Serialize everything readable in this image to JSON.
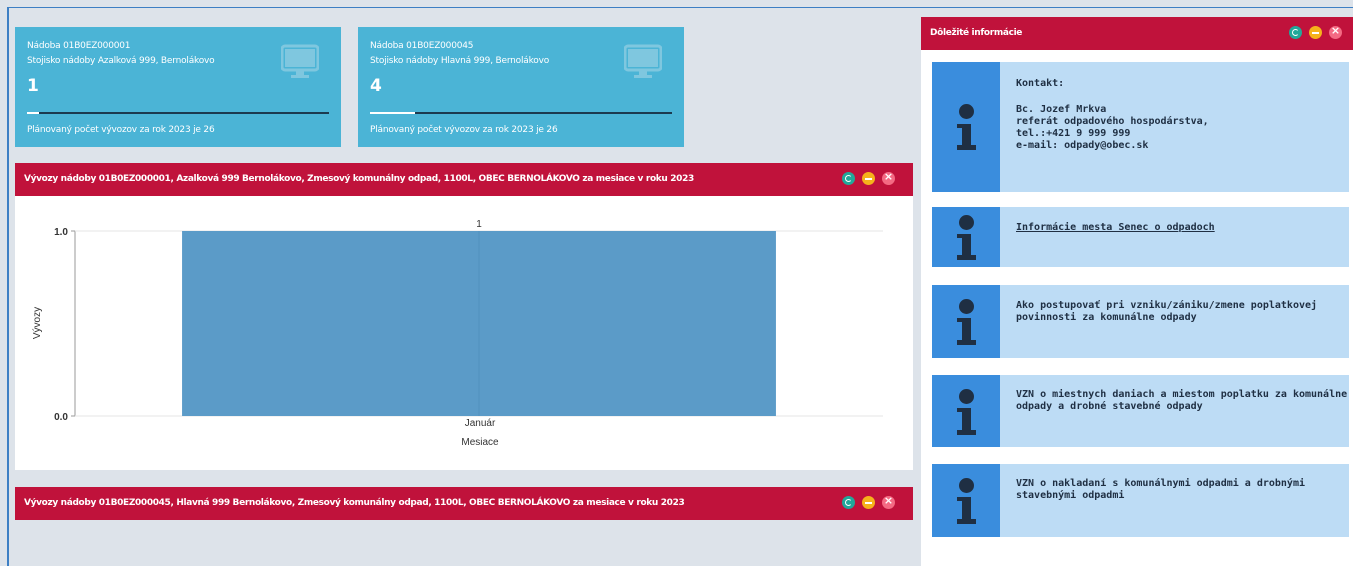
{
  "tiles": [
    {
      "line1": "Nádoba 01B0EZ000001",
      "line2": "Stojisko nádoby Azalková 999, Bernolákovo",
      "count": "1",
      "progress": 0.04,
      "footer": "Plánovaný počet vývozov za rok 2023 je 26",
      "icon": "monitor-icon"
    },
    {
      "line1": "Nádoba 01B0EZ000045",
      "line2": "Stojisko nádoby Hlavná 999, Bernolákovo",
      "count": "4",
      "progress": 0.15,
      "footer": "Plánovaný počet vývozov za rok 2023 je 26",
      "icon": "monitor-icon"
    }
  ],
  "panels": {
    "chart1_title": "Vývozy nádoby 01B0EZ000001, Azalková 999 Bernolákovo, Zmesový komunálny odpad, 1100L, OBEC BERNOLÁKOVO za mesiace v roku 2023",
    "chart2_title": "Vývozy nádoby 01B0EZ000045, Hlavná 999 Bernolákovo, Zmesový komunálny odpad, 1100L, OBEC BERNOLÁKOVO za mesiace v roku 2023",
    "info_title": "Dôležité informácie",
    "controls": [
      "refresh-icon",
      "minimize-icon",
      "close-icon"
    ]
  },
  "chart_data": {
    "type": "bar",
    "categories": [
      "Január"
    ],
    "values": [
      1
    ],
    "data_labels": [
      "1"
    ],
    "xlabel": "Mesiace",
    "ylabel": "Vývozy",
    "ylim": [
      0,
      1
    ],
    "yticks": [
      "0.0",
      "1.0"
    ],
    "bar_color": "#5b9bc8",
    "grid": true
  },
  "info_cards": [
    {
      "lines": [
        "Kontakt:",
        "",
        "Bc. Jozef Mrkva",
        "referát odpadového hospodárstva,",
        "tel.:+421 9 999 999",
        "e-mail:  odpady@obec.sk"
      ]
    },
    {
      "lines": [
        "Informácie mesta Senec o odpadoch"
      ],
      "link": true
    },
    {
      "lines": [
        "Ako postupovať pri vzniku/zániku/zmene poplatkovej",
        "povinnosti za komunálne odpady"
      ]
    },
    {
      "lines": [
        "VZN o miestnych daniach a miestom poplatku za komunálne",
        "odpady a drobné stavebné odpady"
      ]
    },
    {
      "lines": [
        "VZN o nakladaní s komunálnymi odpadmi a drobnými",
        "stavebnými odpadmi"
      ]
    }
  ],
  "colors": {
    "header_red": "#c0123b",
    "tile_blue": "#4bb4d6",
    "card_bg": "#bddcf5",
    "card_icon_bg": "#3a8ddd"
  }
}
